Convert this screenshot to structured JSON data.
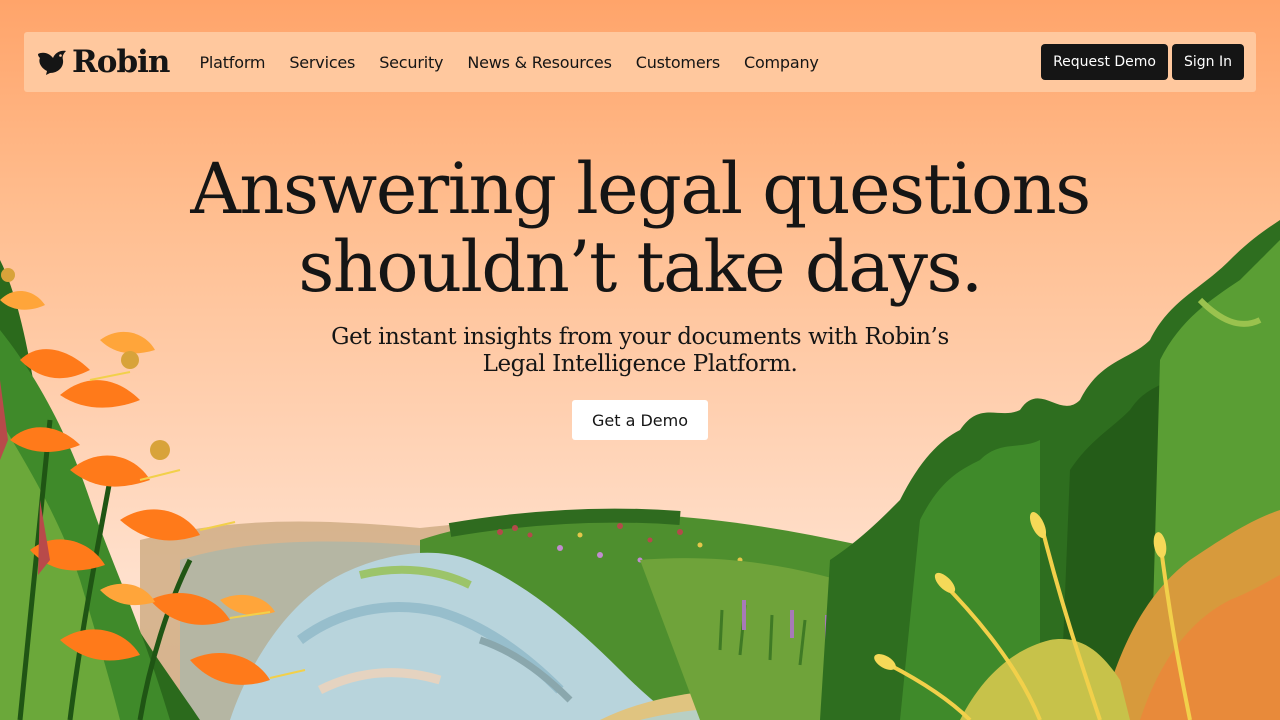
{
  "brand": {
    "name": "Robin"
  },
  "nav": {
    "links": [
      "Platform",
      "Services",
      "Security",
      "News & Resources",
      "Customers",
      "Company"
    ],
    "request_demo": "Request Demo",
    "sign_in": "Sign In"
  },
  "hero": {
    "headline": "Answering legal questions shouldn’t take days.",
    "subheadline": "Get instant insights from your documents with Robin’s Legal Intelligence Platform.",
    "cta": "Get a Demo"
  },
  "colors": {
    "sky_top": "#ffa46a",
    "sky_bottom": "#ffe0cc",
    "nav_bg": "#ffc89e",
    "dark": "#151515",
    "foliage": "#2e7d32",
    "flower": "#ff7a1a"
  },
  "icons": {
    "logo": "robin-bird-icon"
  }
}
